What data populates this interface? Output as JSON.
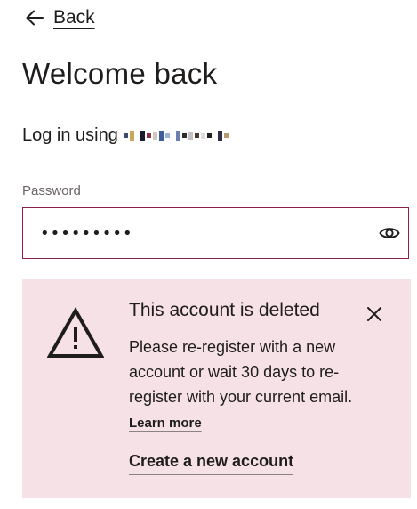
{
  "nav": {
    "back_label": "Back"
  },
  "page": {
    "title": "Welcome back",
    "login_prefix": "Log in using"
  },
  "password": {
    "label": "Password",
    "value": "•••••••••"
  },
  "alert": {
    "title": "This account is deleted",
    "message": "Please re-register with a new account or wait 30 days to re-register with your current email.",
    "learn_more": "Learn more",
    "create_account": "Create a new account"
  },
  "colors": {
    "text": "#1f1c1c",
    "accent_border": "#8a1f4e",
    "alert_background": "#f5e1e6",
    "muted_label": "#6b6565"
  },
  "icons": {
    "back": "arrow-left-icon",
    "show_password": "eye-icon",
    "warning": "warning-triangle-icon",
    "close": "close-icon"
  }
}
